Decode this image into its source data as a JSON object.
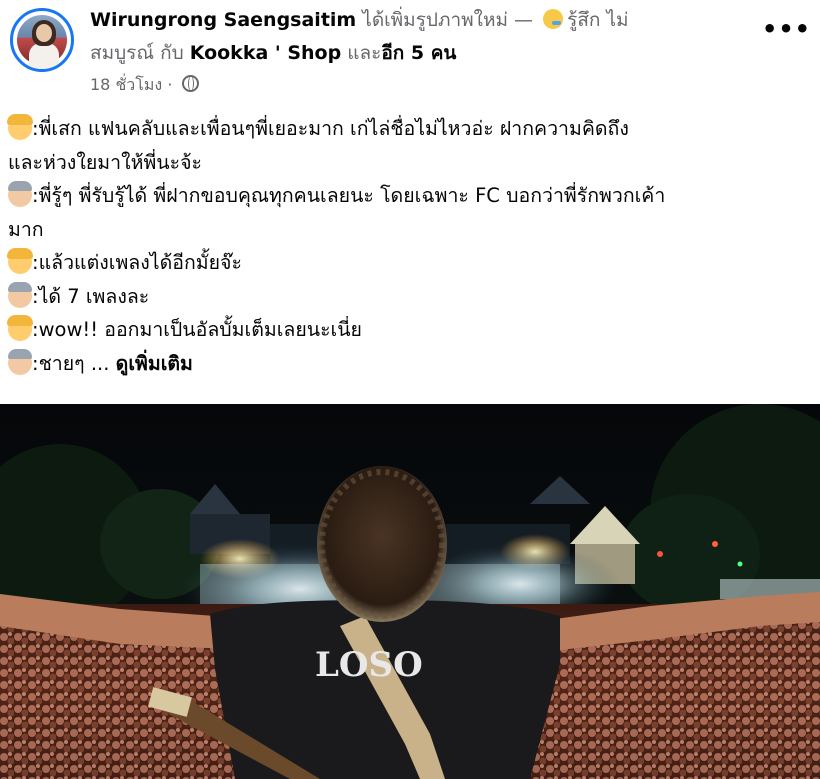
{
  "header": {
    "author": "Wirungrong Saengsaitim",
    "action": "ได้เพิ่มรูปภาพใหม่ —",
    "feeling_emoji": "sad-face-emoji",
    "feeling": "รู้สึก ไม่",
    "line2_feeling": "สมบูรณ์",
    "line2_with": "กับ",
    "tagged_page": "Kookka ' Shop",
    "and_word": "และ",
    "others": "อีก 5 คน"
  },
  "meta": {
    "time": "18 ชั่วโมง",
    "separator": "·",
    "privacy_icon": "globe-icon"
  },
  "more_button": "•••",
  "post": {
    "lines": [
      {
        "emoji": "woman-emoji",
        "text": ":พี่เสก แฟนคลับและเพื่อนๆพี่เยอะมาก เก่ไล่ชื่อไม่ไหวอ่ะ ฝากความคิดถึง"
      },
      {
        "emoji": "",
        "text": "และห่วงใยมาให้พี่นะจ้ะ"
      },
      {
        "emoji": "man-emoji",
        "text": ":พี่รู้ๆ พี่รับรู้ได้ พี่ฝากขอบคุณทุกคนเลยนะ โดยเฉพาะ FC บอกว่าพี่รักพวกเค้า"
      },
      {
        "emoji": "",
        "text": "มาก"
      },
      {
        "emoji": "woman-emoji",
        "text": ":แล้วแต่งเพลงได้อีกมั้ยจ๊ะ"
      },
      {
        "emoji": "man-emoji",
        "text": ":ได้ 7 เพลงละ"
      },
      {
        "emoji": "woman-emoji",
        "text": ":wow!! ออกมาเป็นอัลบั้มเต็มเลยนะเนี่ย"
      }
    ],
    "last_line_emoji": "man-emoji",
    "last_line_text": ":ชายๆ ...",
    "see_more": "ดูเพิ่มเติม"
  },
  "photo": {
    "shirt_text": "LOSO"
  },
  "colors": {
    "author_text": "#050505",
    "muted_text": "#65676b",
    "avatar_ring": "#1877f2"
  }
}
